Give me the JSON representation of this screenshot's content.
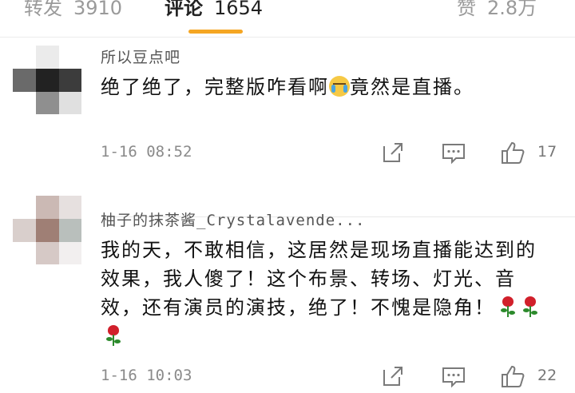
{
  "tabs": [
    {
      "label": "转发",
      "count": "3910",
      "active": false
    },
    {
      "label": "评论",
      "count": "1654",
      "active": true
    },
    {
      "label": "赞",
      "count": "2.8万",
      "active": false
    }
  ],
  "comments": [
    {
      "username": "所以豆点吧",
      "text_before_emoji": "绝了绝了，完整版咋看啊",
      "emoji": "crying-face",
      "text_after_emoji": "竟然是直播。",
      "timestamp": "1-16 08:52",
      "likes": "17"
    },
    {
      "username": "柚子的抹茶酱_Crystalavende...",
      "text": "我的天，不敢相信，这居然是现场直播能达到的效果，我人傻了！这个布景、转场、灯光、音效，还有演员的演技，绝了！不愧是隐角！",
      "emoji": "rose",
      "emoji_count": 3,
      "timestamp": "1-16 10:03",
      "likes": "22"
    }
  ],
  "colors": {
    "accent_underline": "#f5a623",
    "rose": "#d1202b",
    "icon_gray": "#7a7a7a"
  },
  "icons": [
    "share-icon",
    "comment-icon",
    "thumbs-up-icon"
  ]
}
